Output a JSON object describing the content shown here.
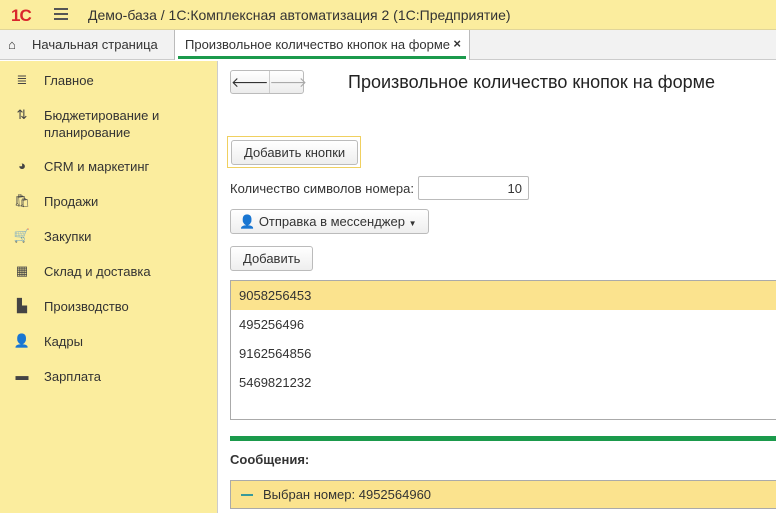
{
  "titlebar": {
    "logo": "1С",
    "title": "Демо-база / 1С:Комплексная автоматизация 2  (1С:Предприятие)"
  },
  "tabs": {
    "home": "Начальная страница",
    "active": "Произвольное количество кнопок на форме",
    "close": "×"
  },
  "sidebar": {
    "items": [
      {
        "label": "Главное",
        "icon": "≣"
      },
      {
        "label": "Бюджетирование и планирование",
        "icon": "⇅"
      },
      {
        "label": "CRM и маркетинг",
        "icon": "◕"
      },
      {
        "label": "Продажи",
        "icon": "🛍"
      },
      {
        "label": "Закупки",
        "icon": "🛒"
      },
      {
        "label": "Склад и доставка",
        "icon": "▦"
      },
      {
        "label": "Производство",
        "icon": "▙"
      },
      {
        "label": "Кадры",
        "icon": "👤"
      },
      {
        "label": "Зарплата",
        "icon": "▬"
      }
    ]
  },
  "form": {
    "back": "🡐",
    "forward": "🡒",
    "title": "Произвольное количество кнопок на форме",
    "add_buttons": "Добавить кнопки",
    "digits_label": "Количество символов номера:",
    "digits_value": "10",
    "messenger": "Отправка в мессенджер",
    "add": "Добавить",
    "numbers": [
      "9058256453",
      "495256496",
      "9162564856",
      "5469821232"
    ],
    "messages_label": "Сообщения:",
    "message": "Выбран номер: 4952564960"
  }
}
